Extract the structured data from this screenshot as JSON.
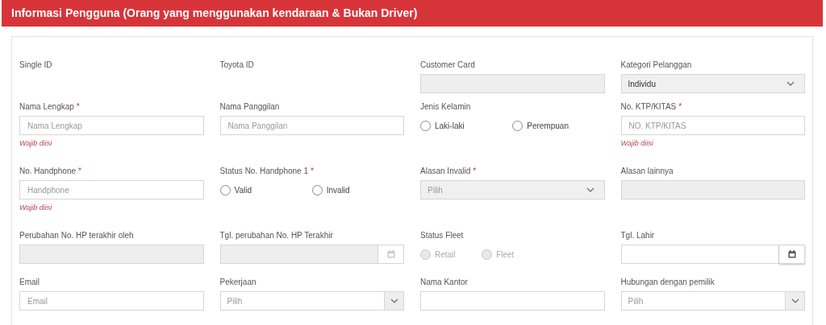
{
  "header": {
    "title": "Informasi Pengguna (Orang yang menggunakan kendaraan & Bukan Driver)"
  },
  "rows": [
    [
      {
        "kind": "plain",
        "label": "Single ID"
      },
      {
        "kind": "plain",
        "label": "Toyota ID"
      },
      {
        "kind": "text",
        "label": "Customer Card",
        "disabled": true
      },
      {
        "kind": "select",
        "label": "Kategori Pelanggan",
        "value": "Individu",
        "disabled": true
      }
    ],
    [
      {
        "kind": "text",
        "label": "Nama Lengkap",
        "required": "*",
        "placeholder": "Nama Lengkap",
        "disabled": false,
        "error": "Wajib diisi"
      },
      {
        "kind": "text",
        "label": "Nama Panggilan",
        "placeholder": "Nama Panggilan",
        "disabled": false
      },
      {
        "kind": "radio",
        "label": "Jenis Kelamin",
        "disabled": false,
        "options": [
          {
            "label": "Laki-laki",
            "selected": false
          },
          {
            "label": "Perempuan",
            "selected": false
          }
        ]
      },
      {
        "kind": "text",
        "label": "No. KTP/KITAS",
        "required": "*",
        "placeholder": "NO. KTP/KITAS",
        "disabled": false,
        "error": "Wajib diisi"
      }
    ],
    [
      {
        "kind": "text",
        "label": "No. Handphone",
        "required": "*",
        "placeholder": "Handphone",
        "disabled": false,
        "error": "Wajib diisi"
      },
      {
        "kind": "radio",
        "label": "Status No. Handphone 1",
        "required": "*",
        "disabled": false,
        "options": [
          {
            "label": "Valid",
            "selected": false
          },
          {
            "label": "Invalid",
            "selected": false
          }
        ]
      },
      {
        "kind": "select",
        "label": "Alasan Invalid",
        "required": "*",
        "placeholder": "Pilih",
        "disabled": true
      },
      {
        "kind": "text",
        "label": "Alasan lainnya",
        "disabled": true
      }
    ],
    [
      {
        "kind": "text",
        "label": "Perubahan No. HP terakhir oleh",
        "disabled": true
      },
      {
        "kind": "date",
        "label": "Tgl. perubahan No. HP Terakhir",
        "disabled": true
      },
      {
        "kind": "radio",
        "label": "Status Fleet",
        "disabled": true,
        "options": [
          {
            "label": "Retail",
            "selected": false
          },
          {
            "label": "Fleet",
            "selected": false
          }
        ]
      },
      {
        "kind": "date",
        "label": "Tgl. Lahir",
        "disabled": false
      }
    ],
    [
      {
        "kind": "text",
        "label": "Email",
        "placeholder": "Email",
        "disabled": false
      },
      {
        "kind": "select",
        "label": "Pekerjaan",
        "placeholder": "Pilih",
        "disabled": false
      },
      {
        "kind": "text",
        "label": "Nama Kantor",
        "disabled": false
      },
      {
        "kind": "select",
        "label": "Hubungan dengan pemilik",
        "placeholder": "Pilih",
        "disabled": false
      }
    ]
  ]
}
